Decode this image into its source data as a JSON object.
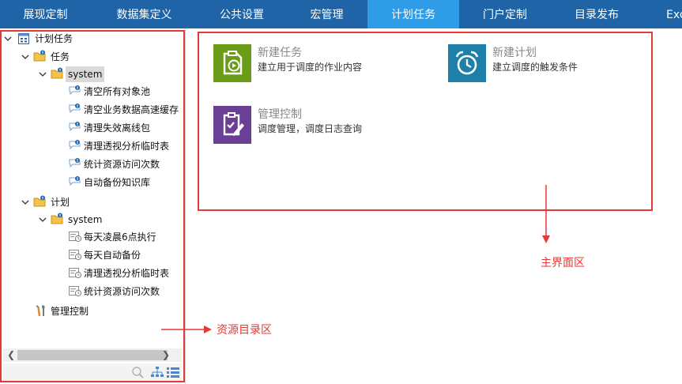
{
  "top_nav": {
    "tabs": [
      {
        "label": "展现定制"
      },
      {
        "label": "数据集定义"
      },
      {
        "label": "公共设置"
      },
      {
        "label": "宏管理"
      },
      {
        "label": "计划任务"
      },
      {
        "label": "门户定制"
      },
      {
        "label": "目录发布"
      },
      {
        "label": "Exc"
      }
    ],
    "active_index": 4,
    "colors": {
      "bar": "#1e64a6",
      "active": "#2f9ce8"
    }
  },
  "tree": {
    "root": {
      "label": "计划任务"
    },
    "tasks": {
      "label": "任务",
      "system_label": "system",
      "items": [
        "清空所有对象池",
        "清空业务数据高速缓存",
        "清理失效离线包",
        "清理透视分析临时表",
        "统计资源访问次数",
        "自动备份知识库"
      ]
    },
    "plans": {
      "label": "计划",
      "system_label": "system",
      "items": [
        "每天凌晨6点执行",
        "每天自动备份",
        "清理透视分析临时表",
        "统计资源访问次数"
      ]
    },
    "management": {
      "label": "管理控制"
    }
  },
  "main": {
    "cards": [
      {
        "title": "新建任务",
        "desc": "建立用于调度的作业内容",
        "icon": "task-doc-play-icon",
        "color": "#6a9c18"
      },
      {
        "title": "新建计划",
        "desc": "建立调度的触发条件",
        "icon": "alarm-clock-icon",
        "color": "#1e7fa8"
      },
      {
        "title": "管理控制",
        "desc": "调度管理，调度日志查询",
        "icon": "clipboard-edit-icon",
        "color": "#6b3f96"
      }
    ]
  },
  "annotations": {
    "main_area": "主界面区",
    "resource_area": "资源目录区",
    "color": "#e53935"
  }
}
